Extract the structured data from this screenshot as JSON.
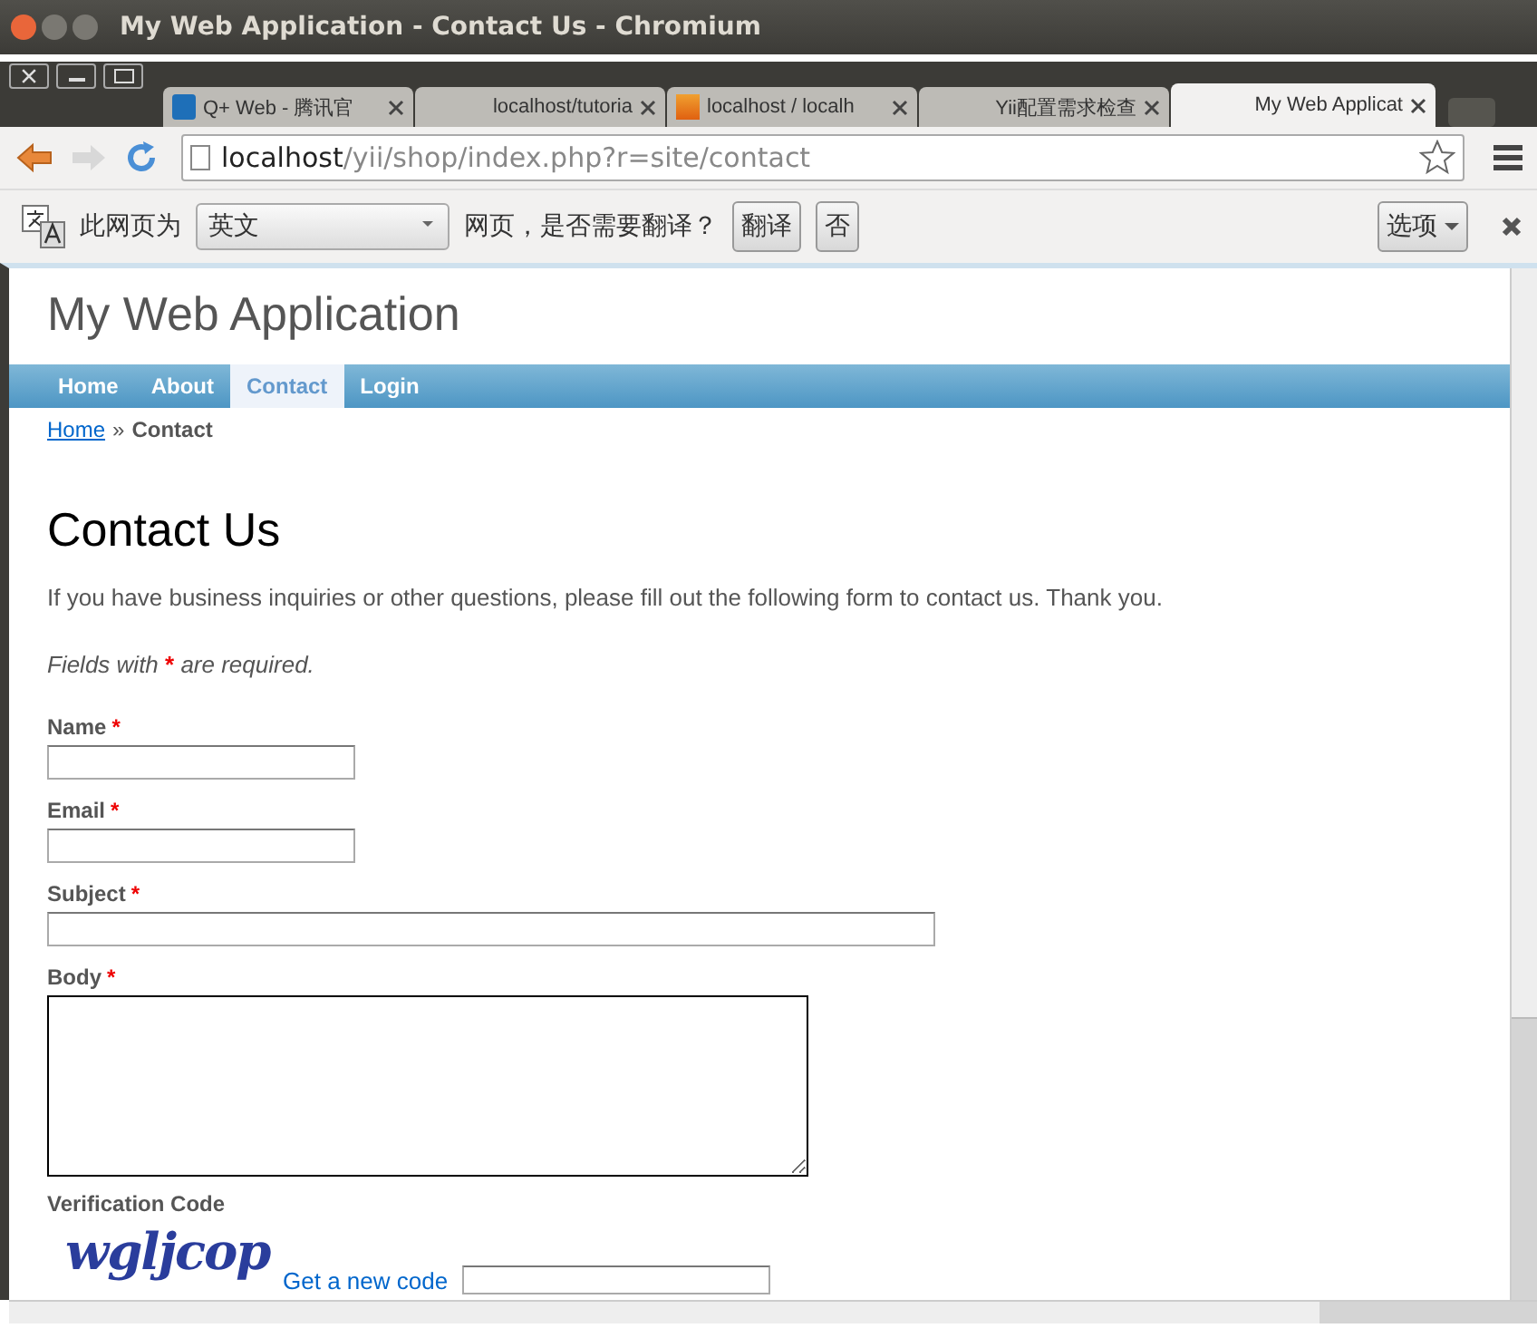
{
  "window": {
    "title": "My Web Application - Contact Us - Chromium"
  },
  "tabs": [
    {
      "label": "Q+ Web - 腾讯官",
      "kind": "q",
      "selected": false
    },
    {
      "label": "localhost/tutoria",
      "kind": "page",
      "selected": false
    },
    {
      "label": "localhost / localh",
      "kind": "pma",
      "selected": false
    },
    {
      "label": "Yii配置需求检查",
      "kind": "page",
      "selected": false
    },
    {
      "label": "My Web Applicat",
      "kind": "page",
      "selected": true
    }
  ],
  "address": {
    "host": "localhost",
    "path": "/yii/shop/index.php?r=site/contact"
  },
  "translate_bar": {
    "prefix": "此网页为",
    "language": "英文",
    "question": "网页，是否需要翻译？",
    "translate_button": "翻译",
    "no_button": "否",
    "options_button": "选项"
  },
  "page": {
    "site_title": "My Web Application",
    "nav": [
      {
        "label": "Home",
        "selected": false
      },
      {
        "label": "About",
        "selected": false
      },
      {
        "label": "Contact",
        "selected": true
      },
      {
        "label": "Login",
        "selected": false
      }
    ],
    "breadcrumb": {
      "link": "Home",
      "separator": "»",
      "current": "Contact"
    },
    "heading": "Contact Us",
    "intro": "If you have business inquiries or other questions, please fill out the following form to contact us. Thank you.",
    "required_note": {
      "before": "Fields with",
      "mark": "*",
      "after": "are required."
    },
    "required_mark": "*",
    "fields": [
      {
        "label": "Name",
        "required": true,
        "kind": "short"
      },
      {
        "label": "Email",
        "required": true,
        "kind": "short"
      },
      {
        "label": "Subject",
        "required": true,
        "kind": "long"
      },
      {
        "label": "Body",
        "required": true,
        "kind": "textarea"
      }
    ],
    "verification": {
      "label": "Verification Code",
      "captcha": "wgljcop",
      "new_code_link": "Get a new code"
    }
  }
}
